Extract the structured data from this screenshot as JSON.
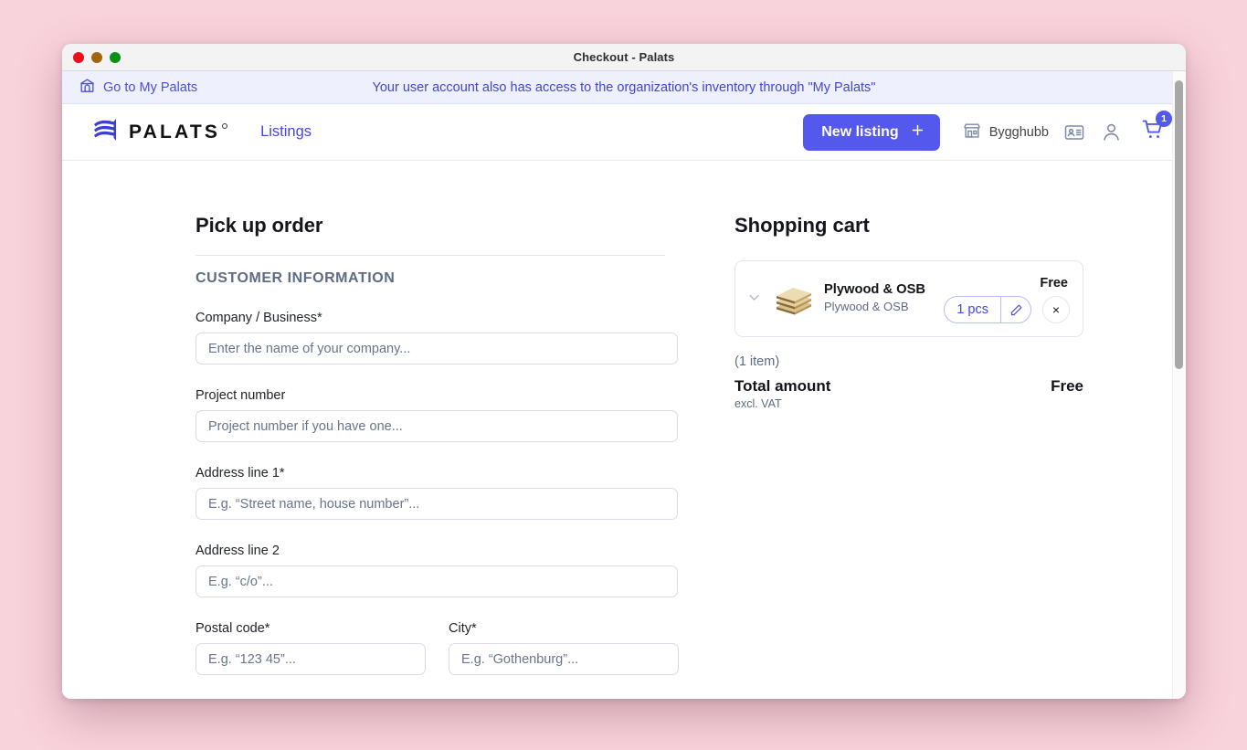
{
  "window": {
    "title": "Checkout - Palats",
    "traffic_lights": [
      "close",
      "minimize",
      "maximize"
    ]
  },
  "notice": {
    "link_label": "Go to My Palats",
    "link_icon": "building-icon",
    "message": "Your user account also has access to the organization's inventory through \"My Palats\""
  },
  "header": {
    "brand_name": "PALATS",
    "brand_icon": "palats-wave-logo",
    "nav": [
      {
        "label": "Listings",
        "name": "nav-listings"
      }
    ],
    "new_listing_label": "New listing",
    "new_listing_icon": "plus-icon",
    "bygghubb_label": "Bygghubb",
    "bygghubb_icon": "storefront-icon",
    "id_card_icon": "id-card-icon",
    "account_icon": "user-icon",
    "cart_icon": "shopping-cart-icon",
    "cart_badge": "1",
    "accent_color": "#5458ec"
  },
  "main": {
    "page_title": "Pick up order",
    "section_label": "CUSTOMER INFORMATION",
    "fields": [
      {
        "name": "company-business",
        "label": "Company / Business*",
        "placeholder": "Enter the name of your company...",
        "value": ""
      },
      {
        "name": "project-number",
        "label": "Project number",
        "placeholder": "Project number if you have one...",
        "value": ""
      },
      {
        "name": "address-line-1",
        "label": "Address line 1*",
        "placeholder": "E.g. “Street name, house number”...",
        "value": ""
      },
      {
        "name": "address-line-2",
        "label": "Address line 2",
        "placeholder": "E.g. “c/o”...",
        "value": ""
      },
      {
        "name": "postal-code",
        "label": "Postal code*",
        "placeholder": "E.g. “123 45”...",
        "value": ""
      },
      {
        "name": "city",
        "label": "City*",
        "placeholder": "E.g. “Gothenburg”...",
        "value": ""
      }
    ]
  },
  "cart": {
    "title": "Shopping cart",
    "collapse_icon": "chevron-down-icon",
    "item": {
      "thumbnail_icon": "plywood-boards-image",
      "name": "Plywood & OSB",
      "subtitle": "Plywood & OSB",
      "price": "Free",
      "quantity": "1 pcs",
      "edit_icon": "pencil-icon",
      "remove_icon": "close-icon",
      "remove_label": "×"
    },
    "item_count": "(1 item)",
    "total_label": "Total amount",
    "total_value": "Free",
    "total_note": "excl. VAT"
  }
}
